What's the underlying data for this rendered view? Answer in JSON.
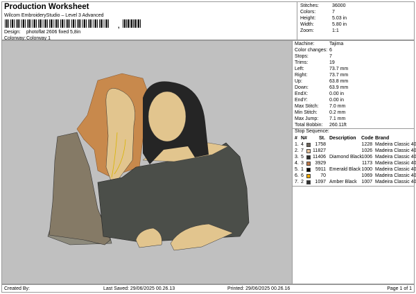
{
  "header": {
    "title": "Production Worksheet",
    "subtitle": "Wilcom EmbroideryStudio – Level 3 Advanced",
    "design_label": "Design:",
    "design_value": "photoflat 2606 fixed 5,8in",
    "colorway_label": "Colorway:",
    "colorway_value": "Colorway 1"
  },
  "stats": [
    {
      "k": "Stitches:",
      "v": "36000"
    },
    {
      "k": "Colors:",
      "v": "7"
    },
    {
      "k": "Height:",
      "v": "5.03 in"
    },
    {
      "k": "Width:",
      "v": "5.80 in"
    },
    {
      "k": "Zoom:",
      "v": "1:1"
    }
  ],
  "details": [
    {
      "k": "Machine:",
      "v": "Tajima"
    },
    {
      "k": "Color changes:",
      "v": "6"
    },
    {
      "k": "Stops:",
      "v": "7"
    },
    {
      "k": "Trims:",
      "v": "19"
    },
    {
      "k": "Left:",
      "v": "73.7 mm"
    },
    {
      "k": "Right:",
      "v": "73.7 mm"
    },
    {
      "k": "Up:",
      "v": "63.8 mm"
    },
    {
      "k": "Down:",
      "v": "63.9 mm"
    },
    {
      "k": "EndX:",
      "v": "0.00 in"
    },
    {
      "k": "EndY:",
      "v": "0.00 in"
    },
    {
      "k": "Max Stitch:",
      "v": "7.0 mm"
    },
    {
      "k": "Min Stitch:",
      "v": "0.2 mm"
    },
    {
      "k": "Max Jump:",
      "v": "7.1 mm"
    },
    {
      "k": "Total Bobbin:",
      "v": "260.11ft"
    }
  ],
  "stop_sequence": {
    "label": "Stop Sequence:",
    "headers": {
      "num": "#",
      "n": "N#",
      "st": "St.",
      "desc": "Description",
      "code": "Code",
      "brand": "Brand"
    },
    "rows": [
      {
        "num": "1.",
        "n": "4",
        "color": "#6e655a",
        "st": "1758",
        "desc": "",
        "code": "1228",
        "brand": "Madeira Classic 40"
      },
      {
        "num": "2.",
        "n": "7",
        "color": "#e8c39a",
        "st": "11827",
        "desc": "",
        "code": "1026",
        "brand": "Madeira Classic 40"
      },
      {
        "num": "3.",
        "n": "5",
        "color": "#2f302e",
        "st": "11406",
        "desc": "Diamond Black",
        "code": "1006",
        "brand": "Madeira Classic 40"
      },
      {
        "num": "4.",
        "n": "3",
        "color": "#c07a48",
        "st": "3929",
        "desc": "",
        "code": "1173",
        "brand": "Madeira Classic 40"
      },
      {
        "num": "5.",
        "n": "1",
        "color": "#000000",
        "st": "5911",
        "desc": "Emerald Black",
        "code": "1000",
        "brand": "Madeira Classic 40"
      },
      {
        "num": "6.",
        "n": "6",
        "color": "#f2aa00",
        "st": "70",
        "desc": "",
        "code": "1069",
        "brand": "Madeira Classic 40"
      },
      {
        "num": "7.",
        "n": "2",
        "color": "#333333",
        "st": "1097",
        "desc": "Amber Black",
        "code": "1007",
        "brand": "Madeira Classic 40"
      }
    ]
  },
  "footer": {
    "created": "Created By:",
    "saved": "Last Saved: 29/06/2025 00.26.13",
    "printed": "Printed: 29/06/2025 00.26.16",
    "page": "Page 1 of 1"
  }
}
